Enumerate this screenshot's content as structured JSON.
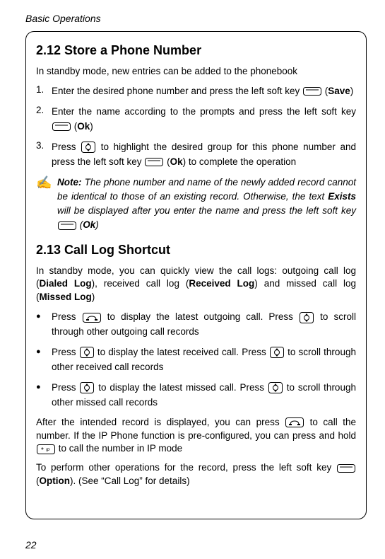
{
  "header": "Basic Operations",
  "page_number": "22",
  "section1": {
    "title": "2.12 Store a Phone Number",
    "intro": "In standby mode, new entries can be added to the phonebook",
    "step1": {
      "num": "1.",
      "text_a": "Enter the desired phone number and press the left soft key ",
      "text_b": " (",
      "save": "Save",
      "text_c": ")"
    },
    "step2": {
      "num": "2.",
      "text_a": "Enter the name according to the prompts and press the left soft key ",
      "text_b": " (",
      "ok": "Ok",
      "text_c": ")"
    },
    "step3": {
      "num": "3.",
      "text_a": "Press ",
      "text_b": " to highlight the desired group for this phone number and press the left soft key ",
      "text_c": " (",
      "ok": "Ok",
      "text_d": ") to complete the operation"
    },
    "note": {
      "label": "Note:",
      "text_a": " The phone number and name of the newly added record cannot be identical to those of an existing record. Otherwise, the text ",
      "exists": "Exists",
      "text_b": " will be displayed after you enter the name and press the left soft key ",
      "text_c": " (",
      "ok": "Ok",
      "text_d": ")"
    }
  },
  "section2": {
    "title": "2.13 Call Log Shortcut",
    "intro_a": "In standby mode, you can quickly view the call logs: outgoing call log (",
    "dialed": "Dialed Log",
    "intro_b": "), received call log (",
    "received": "Received Log",
    "intro_c": ") and missed call log (",
    "missed": "Missed Log",
    "intro_d": ")",
    "b1": {
      "text_a": "Press ",
      "text_b": " to display the latest outgoing call. Press ",
      "text_c": " to scroll through other outgoing call records"
    },
    "b2": {
      "text_a": "Press ",
      "text_b": " to display the latest received call. Press ",
      "text_c": " to scroll through other received call records"
    },
    "b3": {
      "text_a": "Press ",
      "text_b": " to display the latest missed call. Press ",
      "text_c": " to scroll through other missed call records"
    },
    "after_a": "After the intended record is displayed, you can press ",
    "after_b": " to call the number. If the IP Phone function is pre-configured, you can press and hold ",
    "after_c": " to call the number in IP mode",
    "final_a": "To perform other operations for the record, press the left soft key ",
    "final_b": " (",
    "option": "Option",
    "final_c": "). (See “Call Log” for details)"
  }
}
